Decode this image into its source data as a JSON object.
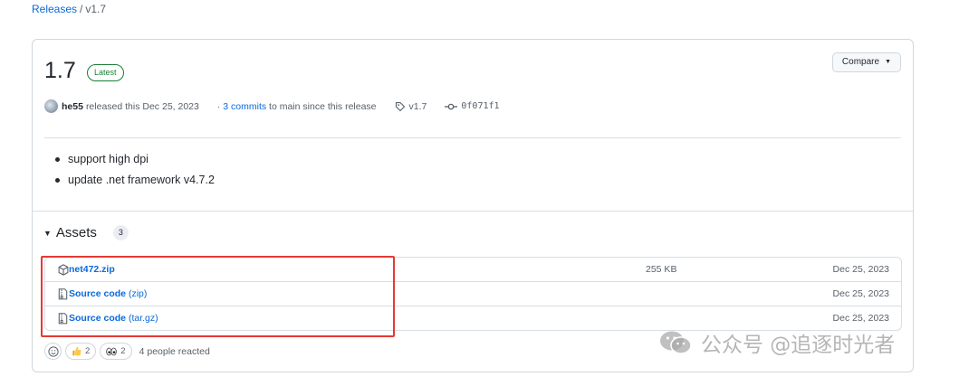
{
  "breadcrumb": {
    "releases": "Releases",
    "sep": "/",
    "current": "v1.7"
  },
  "release": {
    "title": "1.7",
    "badge": "Latest",
    "compare_label": "Compare",
    "author": "he55",
    "released_text": "released this Dec 25, 2023",
    "commits_prefix": "·",
    "commits_link": "3 commits",
    "commits_suffix": "to main since this release",
    "tag": "v1.7",
    "commit_sha": "0f071f1"
  },
  "notes": [
    "support high dpi",
    "update .net framework v4.7.2"
  ],
  "assets": {
    "label": "Assets",
    "count": "3",
    "items": [
      {
        "name": "net472.zip",
        "suffix": "",
        "size": "255 KB",
        "date": "Dec 25, 2023",
        "icon": "package-icon"
      },
      {
        "name": "Source code",
        "suffix": " (zip)",
        "size": "",
        "date": "Dec 25, 2023",
        "icon": "file-zip-icon"
      },
      {
        "name": "Source code",
        "suffix": " (tar.gz)",
        "size": "",
        "date": "Dec 25, 2023",
        "icon": "file-zip-icon"
      }
    ]
  },
  "reactions": {
    "thumbs_up_count": "2",
    "eyes_count": "2",
    "summary": "4 people reacted"
  },
  "watermark": "公众号 @追逐时光者",
  "colors": {
    "link": "#0969da",
    "latest_green": "#1a7f37",
    "highlight_red": "#e53935"
  }
}
